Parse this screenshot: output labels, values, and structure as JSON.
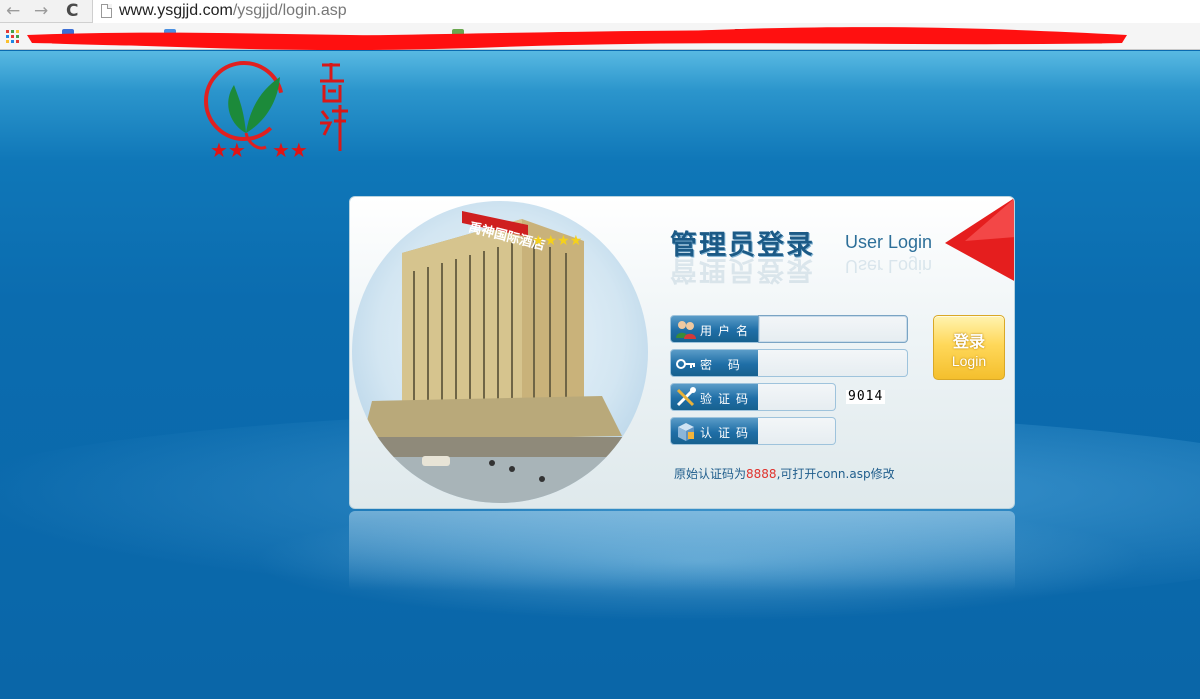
{
  "browser": {
    "back_symbol": "←",
    "forward_symbol": "→",
    "reload_symbol": "C",
    "url_host": "www.ysgjjd.com",
    "url_path": "/ysgjjd/login.asp",
    "bookmark_colors": [
      "#3c6fd6",
      "#4a90e2",
      "#6aa84f",
      "#333333",
      "#4a8fd8"
    ]
  },
  "logo": {
    "colors": {
      "ring": "#e02020",
      "leaf": "#1c8a3a",
      "stars": "#e01414"
    }
  },
  "hotel_image": {
    "sign_text": "禹神国际酒店",
    "stars": "★★★★"
  },
  "login": {
    "title_cn": "管理员登录",
    "title_en": "User Login",
    "fields": [
      {
        "label": "用户名",
        "value": "",
        "icon": "users-icon"
      },
      {
        "label": "密 码",
        "value": "",
        "icon": "key-icon"
      },
      {
        "label": "验证码",
        "value": "",
        "icon": "tools-icon"
      },
      {
        "label": "认证码",
        "value": "",
        "icon": "box-icon"
      }
    ],
    "captcha": "9014",
    "button_cn": "登录",
    "button_en": "Login",
    "hint_prefix": "原始认证码为",
    "hint_code": "8888",
    "hint_suffix": ",可打开conn.asp修改"
  },
  "colors": {
    "page_background": "#0a6bb0",
    "accent_red": "#e0322d",
    "title_blue": "#1c5a86",
    "button_yellow": "#ffd85a"
  }
}
